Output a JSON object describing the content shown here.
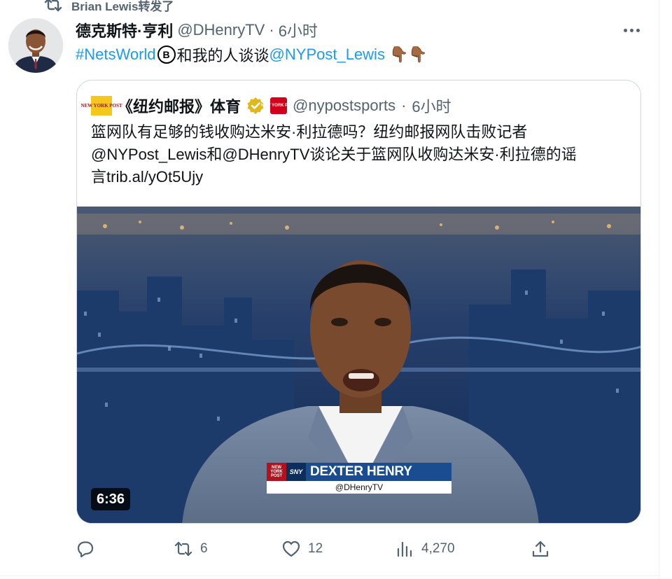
{
  "retweet": {
    "label": "Brian Lewis转发了",
    "icon": "retweet-icon"
  },
  "tweet": {
    "author_name": "德克斯特·亨利",
    "handle": "@DHenryTV",
    "separator": "·",
    "time": "6小时",
    "hashtag": "#NetsWorld",
    "nets_logo_letter": "B",
    "text_middle": "和我的人谈谈",
    "mention": "@NYPost_Lewis",
    "emoji": "👇🏾👇🏾",
    "more_icon": "more-options-icon"
  },
  "quote": {
    "name": "《纽约邮报》体育",
    "logo_text": "NEW YORK POST",
    "handle": "@nypostsports",
    "separator": "·",
    "time": "6小时",
    "body_line1": "篮网队有足够的钱收购达米安·利拉德吗？纽约邮报网队击败记者",
    "body_line2": "@NYPost_Lewis和@DHenryTV谈论关于篮网队收购达米安·利拉德的谣",
    "body_line3": "言trib.al/yOt5Ujy"
  },
  "video": {
    "duration": "6:36",
    "lower_third_name": "DEXTER HENRY",
    "lower_third_handle": "@DHenryTV",
    "lower_third_badge": "NEW YORK POST",
    "lower_third_network": "SNY"
  },
  "actions": {
    "reply_count": "",
    "retweet_count": "6",
    "like_count": "12",
    "views_count": "4,270"
  },
  "colors": {
    "link": "#1d9bf0",
    "muted": "#536471",
    "text": "#0f1419",
    "verified_gold": "#e2b719",
    "border": "#cfd9de"
  }
}
